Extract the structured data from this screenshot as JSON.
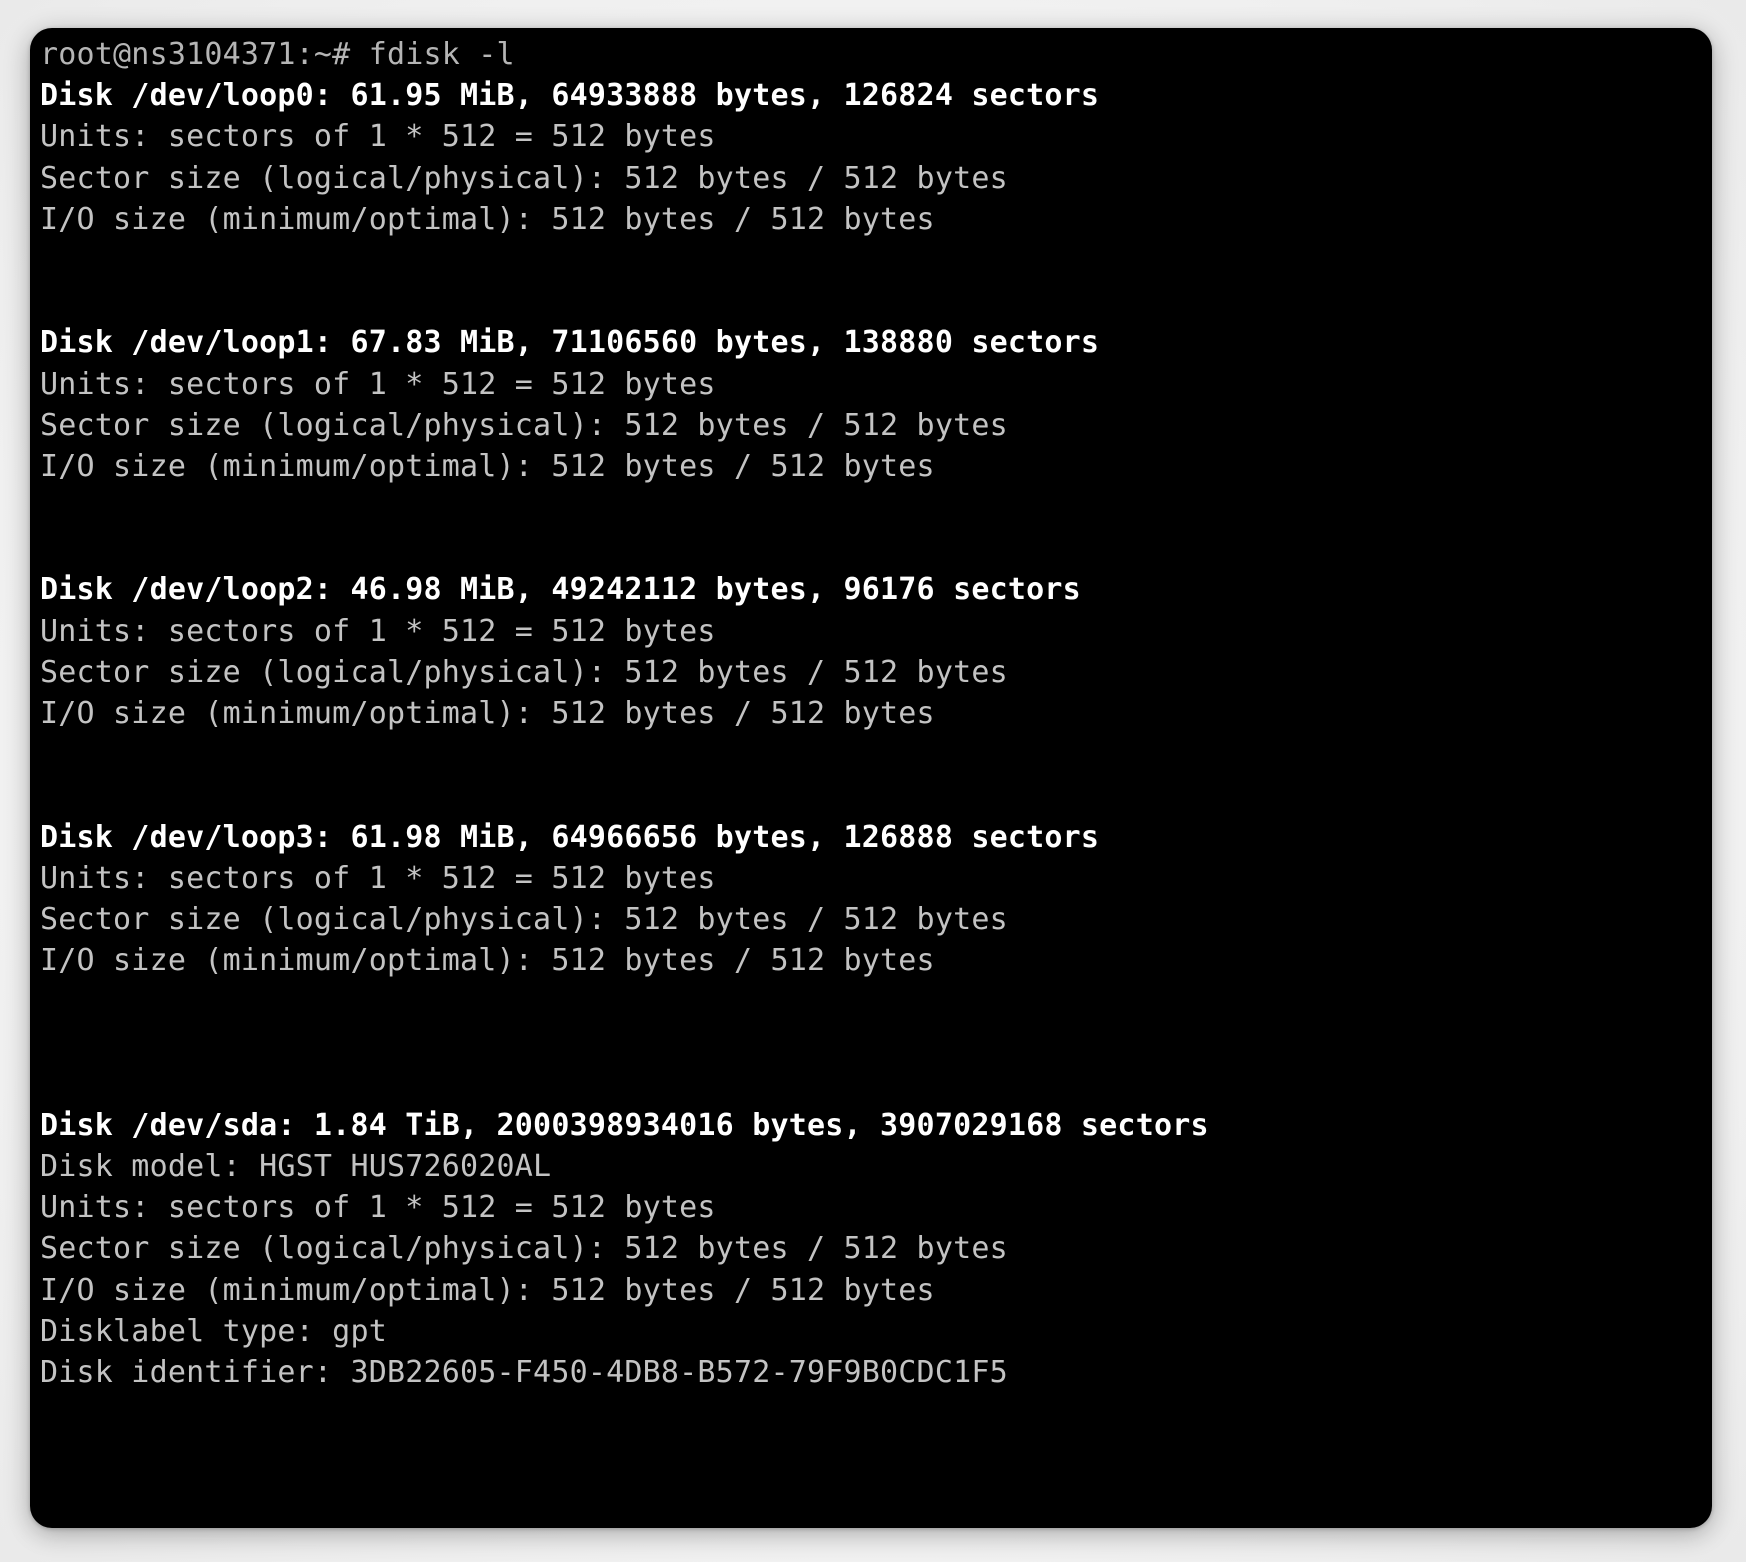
{
  "window": {
    "title": "terminal",
    "background_color": "#000000",
    "text_color": "#c3c3c3",
    "highlight_color": "#ffffff",
    "page_background": "#f1f1f1"
  },
  "terminal": {
    "prompt": "root@ns3104371:~# fdisk -l",
    "lines": [
      {
        "kind": "prompt",
        "text": "root@ns3104371:~# fdisk -l"
      },
      {
        "kind": "header",
        "text": "Disk /dev/loop0: 61.95 MiB, 64933888 bytes, 126824 sectors"
      },
      {
        "kind": "normal",
        "text": "Units: sectors of 1 * 512 = 512 bytes"
      },
      {
        "kind": "normal",
        "text": "Sector size (logical/physical): 512 bytes / 512 bytes"
      },
      {
        "kind": "normal",
        "text": "I/O size (minimum/optimal): 512 bytes / 512 bytes"
      },
      {
        "kind": "blank",
        "text": " "
      },
      {
        "kind": "blank",
        "text": " "
      },
      {
        "kind": "header",
        "text": "Disk /dev/loop1: 67.83 MiB, 71106560 bytes, 138880 sectors"
      },
      {
        "kind": "normal",
        "text": "Units: sectors of 1 * 512 = 512 bytes"
      },
      {
        "kind": "normal",
        "text": "Sector size (logical/physical): 512 bytes / 512 bytes"
      },
      {
        "kind": "normal",
        "text": "I/O size (minimum/optimal): 512 bytes / 512 bytes"
      },
      {
        "kind": "blank",
        "text": " "
      },
      {
        "kind": "blank",
        "text": " "
      },
      {
        "kind": "header",
        "text": "Disk /dev/loop2: 46.98 MiB, 49242112 bytes, 96176 sectors"
      },
      {
        "kind": "normal",
        "text": "Units: sectors of 1 * 512 = 512 bytes"
      },
      {
        "kind": "normal",
        "text": "Sector size (logical/physical): 512 bytes / 512 bytes"
      },
      {
        "kind": "normal",
        "text": "I/O size (minimum/optimal): 512 bytes / 512 bytes"
      },
      {
        "kind": "blank",
        "text": " "
      },
      {
        "kind": "blank",
        "text": " "
      },
      {
        "kind": "header",
        "text": "Disk /dev/loop3: 61.98 MiB, 64966656 bytes, 126888 sectors"
      },
      {
        "kind": "normal",
        "text": "Units: sectors of 1 * 512 = 512 bytes"
      },
      {
        "kind": "normal",
        "text": "Sector size (logical/physical): 512 bytes / 512 bytes"
      },
      {
        "kind": "normal",
        "text": "I/O size (minimum/optimal): 512 bytes / 512 bytes"
      },
      {
        "kind": "blank",
        "text": " "
      },
      {
        "kind": "blank",
        "text": " "
      },
      {
        "kind": "blank",
        "text": " "
      },
      {
        "kind": "header",
        "text": "Disk /dev/sda: 1.84 TiB, 2000398934016 bytes, 3907029168 sectors"
      },
      {
        "kind": "normal",
        "text": "Disk model: HGST HUS726020AL"
      },
      {
        "kind": "normal",
        "text": "Units: sectors of 1 * 512 = 512 bytes"
      },
      {
        "kind": "normal",
        "text": "Sector size (logical/physical): 512 bytes / 512 bytes"
      },
      {
        "kind": "normal",
        "text": "I/O size (minimum/optimal): 512 bytes / 512 bytes"
      },
      {
        "kind": "normal",
        "text": "Disklabel type: gpt"
      },
      {
        "kind": "normal",
        "text": "Disk identifier: 3DB22605-F450-4DB8-B572-79F9B0CDC1F5"
      }
    ]
  },
  "disks": [
    {
      "device": "/dev/loop0",
      "size_human": "61.95 MiB",
      "size_bytes": "64933888",
      "sectors": "126824",
      "units": "sectors of 1 * 512 = 512 bytes",
      "sector_size": "512 bytes / 512 bytes",
      "io_size": "512 bytes / 512 bytes"
    },
    {
      "device": "/dev/loop1",
      "size_human": "67.83 MiB",
      "size_bytes": "71106560",
      "sectors": "138880",
      "units": "sectors of 1 * 512 = 512 bytes",
      "sector_size": "512 bytes / 512 bytes",
      "io_size": "512 bytes / 512 bytes"
    },
    {
      "device": "/dev/loop2",
      "size_human": "46.98 MiB",
      "size_bytes": "49242112",
      "sectors": "96176",
      "units": "sectors of 1 * 512 = 512 bytes",
      "sector_size": "512 bytes / 512 bytes",
      "io_size": "512 bytes / 512 bytes"
    },
    {
      "device": "/dev/loop3",
      "size_human": "61.98 MiB",
      "size_bytes": "64966656",
      "sectors": "126888",
      "units": "sectors of 1 * 512 = 512 bytes",
      "sector_size": "512 bytes / 512 bytes",
      "io_size": "512 bytes / 512 bytes"
    },
    {
      "device": "/dev/sda",
      "size_human": "1.84 TiB",
      "size_bytes": "2000398934016",
      "sectors": "3907029168",
      "model": "HGST HUS726020AL",
      "units": "sectors of 1 * 512 = 512 bytes",
      "sector_size": "512 bytes / 512 bytes",
      "io_size": "512 bytes / 512 bytes",
      "disklabel_type": "gpt",
      "disk_identifier": "3DB22605-F450-4DB8-B572-79F9B0CDC1F5"
    }
  ]
}
